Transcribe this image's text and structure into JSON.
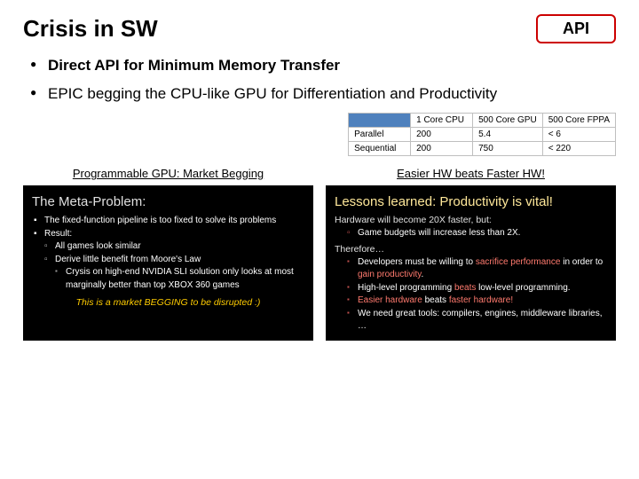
{
  "header": {
    "title": "Crisis in SW",
    "api_label": "API"
  },
  "bullets": [
    "Direct API for Minimum Memory Transfer",
    "EPIC begging the CPU-like GPU for Differentiation and Productivity"
  ],
  "table": {
    "cols": [
      "1 Core CPU",
      "500 Core GPU",
      "500 Core FPPA"
    ],
    "rows": [
      {
        "label": "Parallel",
        "cells": [
          "200",
          "5.4",
          "< 6"
        ]
      },
      {
        "label": "Sequential",
        "cells": [
          "200",
          "750",
          "< 220"
        ]
      }
    ]
  },
  "left": {
    "caption": "Programmable GPU: Market Begging",
    "heading": "The Meta-Problem:",
    "items": {
      "a": "The fixed-function pipeline is too fixed to solve its problems",
      "b": "Result:",
      "b1": "All games look similar",
      "b2": "Derive little benefit from Moore's Law",
      "b3": "Crysis on high-end NVIDIA SLI solution only looks at most marginally better than top XBOX 360 games"
    },
    "callout": "This is a market BEGGING to be disrupted :)"
  },
  "right": {
    "caption": "Easier HW beats Faster HW!",
    "heading": "Lessons learned: Productivity is vital!",
    "sect1": "Hardware will become 20X faster, but:",
    "s1a": "Game budgets will increase less than 2X.",
    "sect2": "Therefore…",
    "s2a_pre": "Developers must be willing to ",
    "s2a_em": "sacrifice performance",
    "s2a_post": " in order to ",
    "s2a_em2": "gain productivity",
    "s2a_end": ".",
    "s2b_pre": "High-level programming ",
    "s2b_em": "beats",
    "s2b_post": " low-level programming.",
    "s2c_pre": "Easier hardware ",
    "s2c_em": "beats ",
    "s2c_post": "faster hardware!",
    "s2d": "We need great tools: compilers, engines, middleware libraries, …"
  }
}
